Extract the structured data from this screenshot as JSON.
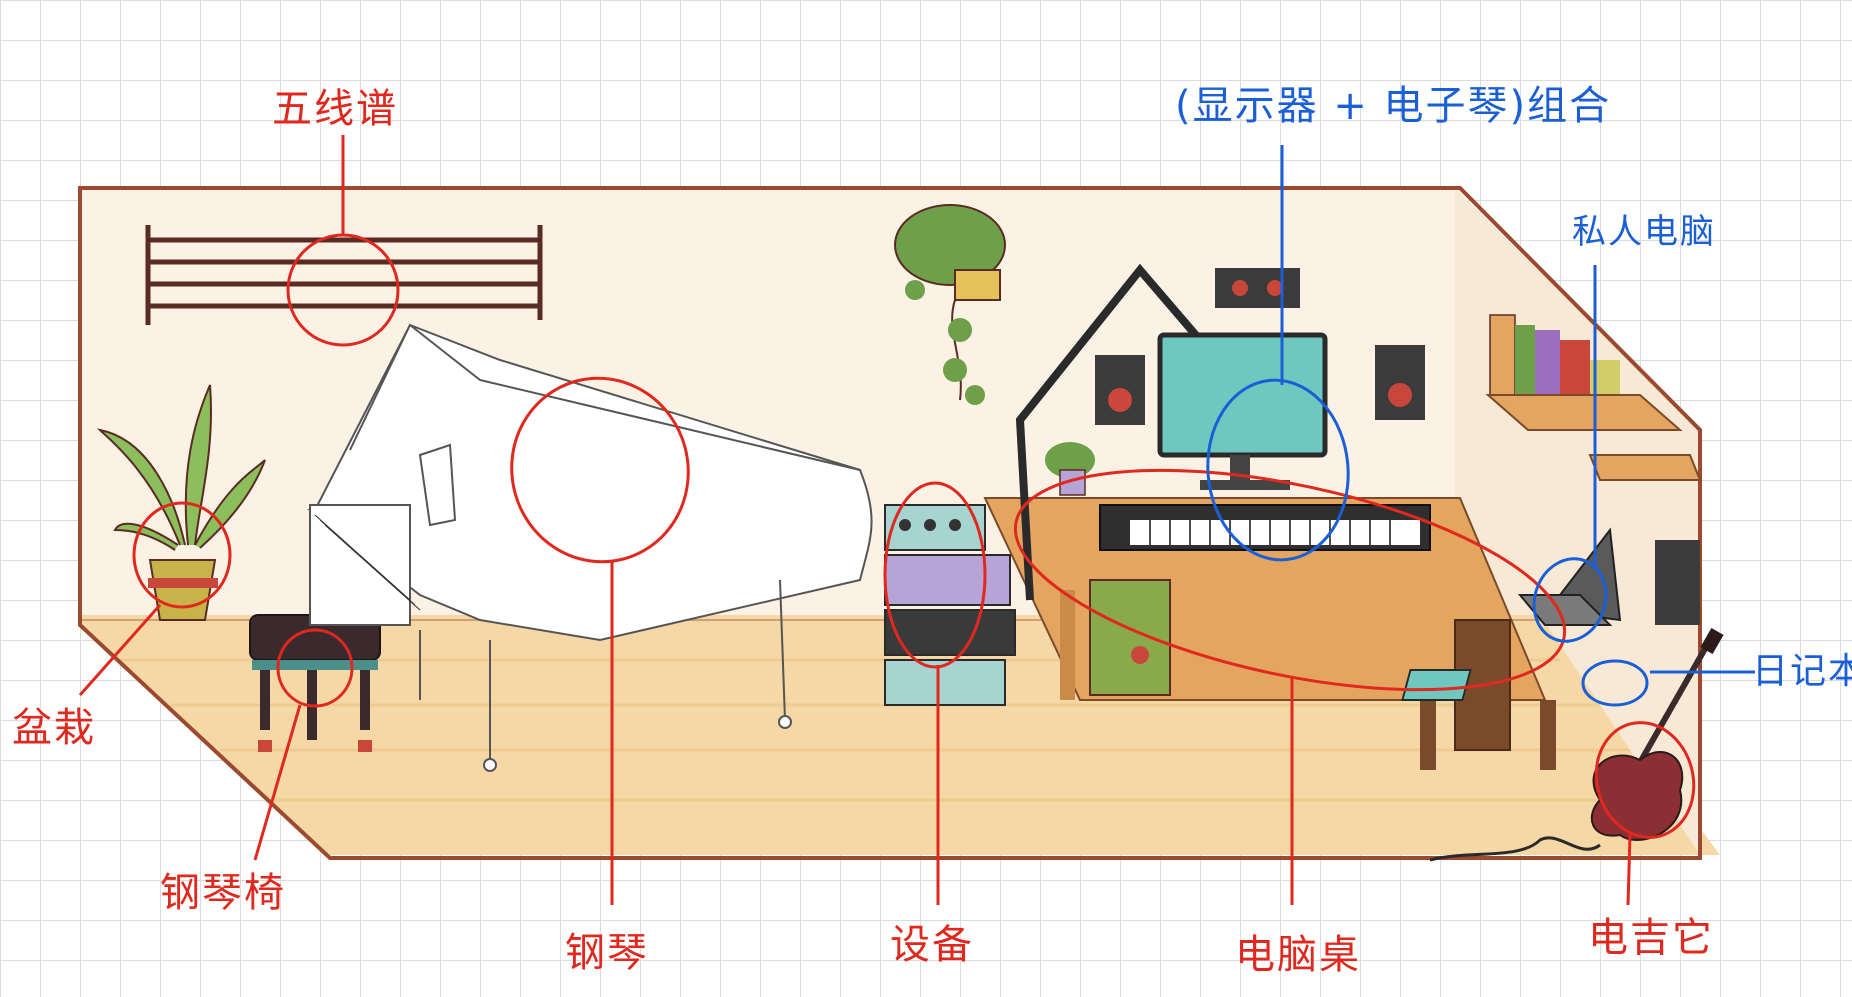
{
  "labels": {
    "staff": "五线谱",
    "combo": "(显示器 + 电子琴)组合",
    "personal_computer": "私人电脑",
    "notebook": "日记本",
    "potted_plant": "盆栽",
    "piano_bench": "钢琴椅",
    "piano": "钢琴",
    "equipment": "设备",
    "computer_desk": "电脑桌",
    "electric_guitar": "电吉它"
  },
  "colors": {
    "annotation_red": "#e0281e",
    "annotation_blue": "#1a5fd6",
    "room_outline": "#9b4a2f",
    "wall": "#fbf1e4",
    "floor": "#f6d7a6"
  }
}
